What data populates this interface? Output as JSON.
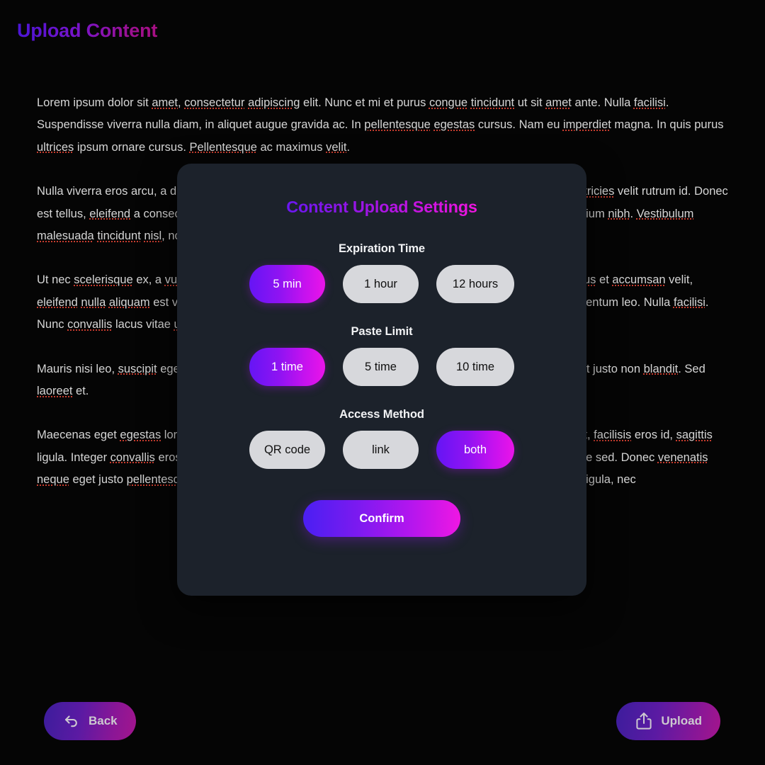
{
  "page": {
    "title": "Upload Content",
    "title_gradient_from": "#4b15d6",
    "title_gradient_to": "#a80f83",
    "background": "#050505"
  },
  "content": {
    "paragraphs": [
      "Lorem ipsum dolor sit amet, consectetur adipiscing elit. Nunc et mi et purus congue tincidunt ut sit amet ante. Nulla facilisi. Suspendisse viverra nulla diam, in aliquet augue gravida ac. In pellentesque egestas cursus. Nam eu imperdiet magna. In quis purus ultrices ipsum ornare cursus. Pellentesque ac maximus velit.",
      "Nulla viverra eros arcu, a dictum nunc. Parturient montes, nascetur ridiculus mus. Suspendisse potenti. Ultricies velit rutrum id. Donec est tellus, eleifend a consectetur adipiscing elit. Fusce sodales justo non nulla vulputate tincidunt. Sed pretium nibh. Vestibulum malesuada tincidunt nisl, non fringilla orci. In hac habitasse platea dictumst.",
      "Ut nec scelerisque ex, a vulputate eu massa quis consectetur. Vestibulum iaculis eros cursus vitae. Vivamus et accumsan velit, eleifend nulla aliquam est vel enim commodo, at faucibus turpis, sodales tristique ligula ac, sagittis condimentum leo. Nulla facilisi. Nunc convallis lacus vitae ultricies.",
      "Mauris nisi leo, suscipit eget cursus. Nam sollicitudin tellus eget dolor cursus, in ultrices. Quisque viverra ut justo non blandit. Sed laoreet et.",
      "Maecenas eget egestas lorem. Cras non nulla vel neque condimentum lobortis. Vestibulum a nisl hendrerit, facilisis eros id, sagittis ligula. Integer convallis eros eget lorem pellentesque convallis. In bibendum ex justo, vel gravida nisl ornare sed. Donec venenatis neque eget justo pellentesque volutpat. Mauris eu purus sed velit convallis egestas. Nullam quis tincidunt ligula, nec"
    ]
  },
  "modal": {
    "title": "Content Upload Settings",
    "background": "#1c222b",
    "active_gradient_from": "#6515f5",
    "active_gradient_to": "#ea14e8",
    "inactive_color": "#d7d8dc",
    "groups": [
      {
        "label": "Expiration Time",
        "options": [
          {
            "label": "5 min",
            "selected": true
          },
          {
            "label": "1 hour",
            "selected": false
          },
          {
            "label": "12 hours",
            "selected": false
          }
        ]
      },
      {
        "label": "Paste Limit",
        "options": [
          {
            "label": "1 time",
            "selected": true
          },
          {
            "label": "5 time",
            "selected": false
          },
          {
            "label": "10 time",
            "selected": false
          }
        ]
      },
      {
        "label": "Access Method",
        "options": [
          {
            "label": "QR code",
            "selected": false
          },
          {
            "label": "link",
            "selected": false
          },
          {
            "label": "both",
            "selected": true
          }
        ]
      }
    ],
    "confirm_label": "Confirm"
  },
  "footer": {
    "back": {
      "label": "Back",
      "icon": "back-arrow-icon"
    },
    "upload": {
      "label": "Upload",
      "icon": "upload-share-icon"
    }
  }
}
